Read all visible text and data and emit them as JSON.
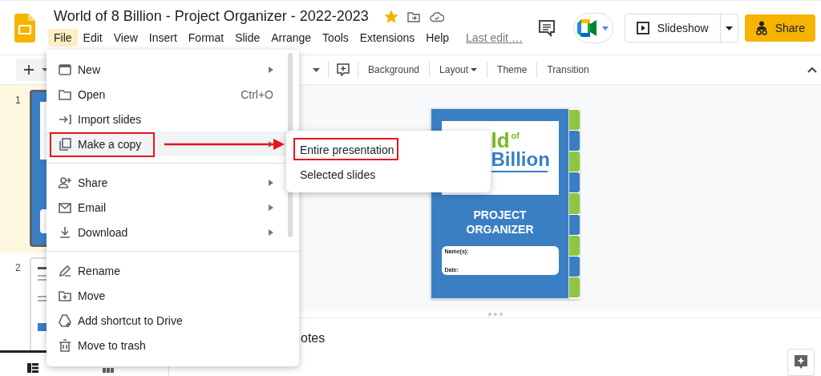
{
  "app": {
    "title": "World of 8 Billion - Project Organizer - 2022-2023",
    "starred": true,
    "last_edit": "Last edit …"
  },
  "menubar": [
    {
      "label": "File",
      "selected": true
    },
    {
      "label": "Edit",
      "selected": false
    },
    {
      "label": "View",
      "selected": false
    },
    {
      "label": "Insert",
      "selected": false
    },
    {
      "label": "Format",
      "selected": false
    },
    {
      "label": "Slide",
      "selected": false
    },
    {
      "label": "Arrange",
      "selected": false
    },
    {
      "label": "Tools",
      "selected": false
    },
    {
      "label": "Extensions",
      "selected": false
    },
    {
      "label": "Help",
      "selected": false
    }
  ],
  "header_buttons": {
    "slideshow": "Slideshow",
    "share": "Share"
  },
  "toolbar": [
    {
      "label": "Background",
      "dropdown": false
    },
    {
      "label": "Layout",
      "dropdown": true
    },
    {
      "label": "Theme",
      "dropdown": false
    },
    {
      "label": "Transition",
      "dropdown": false
    }
  ],
  "filmstrip": [
    {
      "number": "1",
      "selected": true
    },
    {
      "number": "2",
      "selected": false
    }
  ],
  "slide": {
    "logo_part_1": "ld",
    "logo_of": "of",
    "logo_part_2": "Billion",
    "title": "PROJECT ORGANIZER",
    "fields": [
      "Name(s):",
      "Date:"
    ],
    "tabs": [
      {
        "color": "#8dc63f"
      },
      {
        "color": "#3a7fc4"
      },
      {
        "color": "#8dc63f"
      },
      {
        "color": "#3a7fc4"
      },
      {
        "color": "#8dc63f"
      },
      {
        "color": "#3a7fc4"
      },
      {
        "color": "#8dc63f"
      },
      {
        "color": "#3a7fc4"
      },
      {
        "color": "#8dc63f"
      }
    ]
  },
  "notes": "otes",
  "file_menu": {
    "groups": [
      [
        {
          "label": "New",
          "submenu": true,
          "highlighted": false
        },
        {
          "label": "Open",
          "shortcut": "Ctrl+O",
          "submenu": false,
          "highlighted": false
        },
        {
          "label": "Import slides",
          "submenu": false,
          "highlighted": false
        },
        {
          "label": "Make a copy",
          "submenu": true,
          "highlighted": true
        }
      ],
      [
        {
          "label": "Share",
          "submenu": true,
          "highlighted": false
        },
        {
          "label": "Email",
          "submenu": true,
          "highlighted": false
        },
        {
          "label": "Download",
          "submenu": true,
          "highlighted": false
        }
      ],
      [
        {
          "label": "Rename",
          "submenu": false,
          "highlighted": false
        },
        {
          "label": "Move",
          "submenu": false,
          "highlighted": false
        },
        {
          "label": "Add shortcut to Drive",
          "submenu": false,
          "highlighted": false
        },
        {
          "label": "Move to trash",
          "submenu": false,
          "highlighted": false
        }
      ]
    ]
  },
  "submenu": [
    {
      "label": "Entire presentation"
    },
    {
      "label": "Selected slides"
    }
  ]
}
